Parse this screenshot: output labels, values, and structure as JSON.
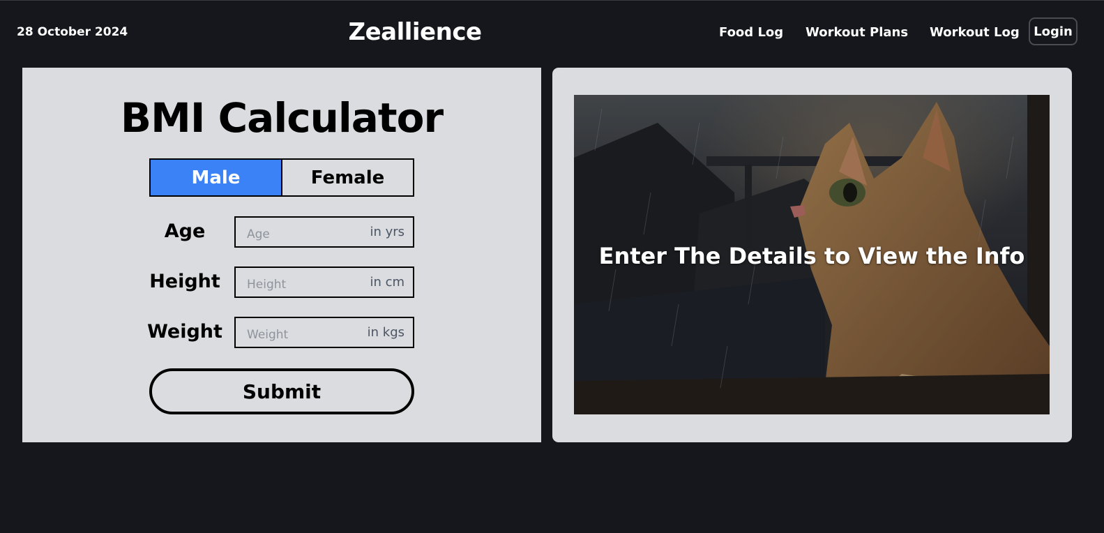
{
  "header": {
    "date": "28 October 2024",
    "brand": "Zeallience",
    "nav": [
      "Food Log",
      "Workout Plans",
      "Workout Log"
    ],
    "login": "Login"
  },
  "calculator": {
    "title": "BMI Calculator",
    "gender": {
      "options": [
        "Male",
        "Female"
      ],
      "selected": "Male"
    },
    "fields": [
      {
        "label": "Age",
        "placeholder": "Age",
        "unit": "in yrs"
      },
      {
        "label": "Height",
        "placeholder": "Height",
        "unit": "in cm"
      },
      {
        "label": "Weight",
        "placeholder": "Weight",
        "unit": "in kgs"
      }
    ],
    "submit": "Submit"
  },
  "info_panel": {
    "message": "Enter The Details to View the Info",
    "image": "cat-in-rain-illustration"
  },
  "colors": {
    "background": "#16171c",
    "panel": "#dadce0",
    "accent": "#3b82f6"
  }
}
